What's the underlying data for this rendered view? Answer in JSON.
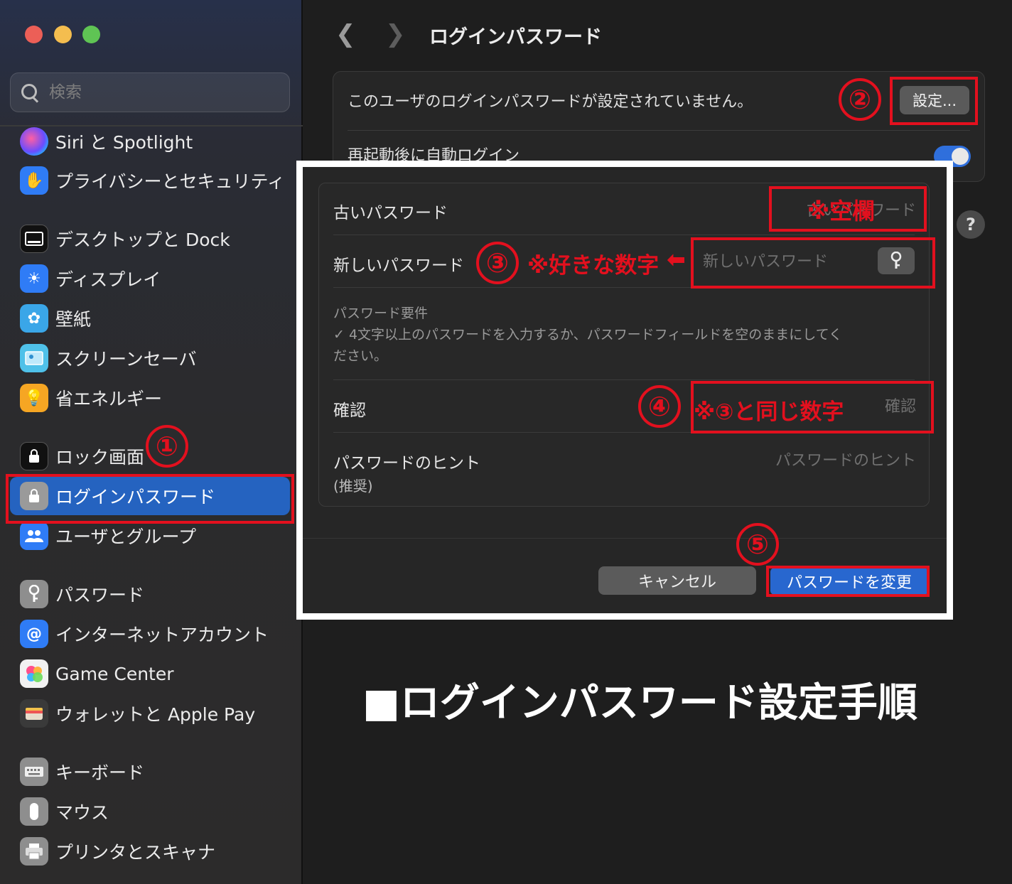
{
  "window": {
    "title": "ログインパスワード"
  },
  "sidebar": {
    "search_placeholder": "検索",
    "items": [
      {
        "label": "Siri と Spotlight",
        "icon": "siri-icon"
      },
      {
        "label": "プライバシーとセキュリティ",
        "icon": "privacy-hand-icon"
      },
      {
        "label": "デスクトップと Dock",
        "icon": "desktop-dock-icon"
      },
      {
        "label": "ディスプレイ",
        "icon": "display-brightness-icon"
      },
      {
        "label": "壁紙",
        "icon": "wallpaper-flower-icon"
      },
      {
        "label": "スクリーンセーバ",
        "icon": "screensaver-icon"
      },
      {
        "label": "省エネルギー",
        "icon": "energy-bulb-icon"
      },
      {
        "label": "ロック画面",
        "icon": "lock-screen-icon"
      },
      {
        "label": "ログインパスワード",
        "icon": "login-password-lock-icon",
        "selected": true
      },
      {
        "label": "ユーザとグループ",
        "icon": "users-groups-icon"
      },
      {
        "label": "パスワード",
        "icon": "passwords-key-icon"
      },
      {
        "label": "インターネットアカウント",
        "icon": "internet-accounts-at-icon"
      },
      {
        "label": "Game Center",
        "icon": "game-center-icon"
      },
      {
        "label": "ウォレットと Apple Pay",
        "icon": "wallet-icon"
      },
      {
        "label": "キーボード",
        "icon": "keyboard-icon"
      },
      {
        "label": "マウス",
        "icon": "mouse-icon"
      },
      {
        "label": "プリンタとスキャナ",
        "icon": "printer-icon"
      }
    ]
  },
  "main": {
    "status_text": "このユーザのログインパスワードが設定されていません。",
    "settings_button": "設定...",
    "auto_login_label": "再起動後に自動ログイン",
    "auto_login_on": true,
    "help": "?"
  },
  "dialog": {
    "old_password_label": "古いパスワード",
    "old_password_placeholder": "古いパスワード",
    "new_password_label": "新しいパスワード",
    "new_password_placeholder": "新しいパスワード",
    "requirements_title": "パスワード要件",
    "requirements_text": "✓ 4文字以上のパスワードを入力するか、パスワードフィールドを空のままにしてください。",
    "confirm_label": "確認",
    "confirm_placeholder": "確認",
    "hint_label": "パスワードのヒント",
    "hint_sub": "(推奨)",
    "hint_placeholder": "パスワードのヒント",
    "cancel_button": "キャンセル",
    "change_button": "パスワードを変更"
  },
  "annotations": {
    "step1": "①",
    "step2": "②",
    "step3": "③",
    "step4": "④",
    "step5": "⑤",
    "note_old": "※空欄",
    "note_new": "※好きな数字",
    "note_confirm": "※③と同じ数字",
    "arrow": "⬅",
    "caption": "■ログインパスワード設定手順"
  },
  "colors": {
    "annotation_red": "#e3101e",
    "accent_blue": "#2563c0"
  }
}
